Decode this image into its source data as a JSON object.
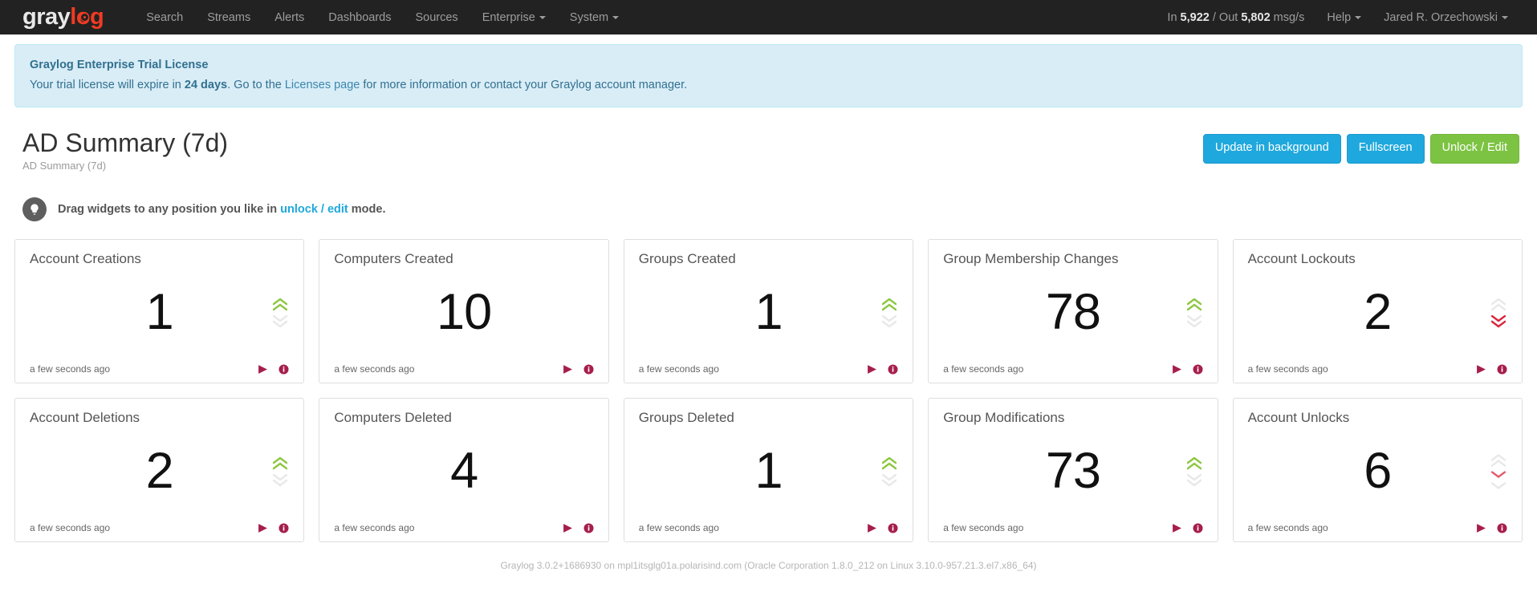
{
  "navbar": {
    "brand": {
      "gray": "gray",
      "log": "log"
    },
    "links": [
      {
        "label": "Search",
        "caret": false
      },
      {
        "label": "Streams",
        "caret": false
      },
      {
        "label": "Alerts",
        "caret": false
      },
      {
        "label": "Dashboards",
        "caret": false
      },
      {
        "label": "Sources",
        "caret": false
      },
      {
        "label": "Enterprise",
        "caret": true
      },
      {
        "label": "System",
        "caret": true
      }
    ],
    "throughput": {
      "in_prefix": "In ",
      "in_value": "5,922",
      "separator": " / Out ",
      "out_value": "5,802",
      "suffix": " msg/s"
    },
    "help_label": "Help",
    "user_label": "Jared R. Orzechowski"
  },
  "banner": {
    "title": "Graylog Enterprise Trial License",
    "body_before": "Your trial license will expire in ",
    "days": "24 days",
    "body_middle": ". Go to the ",
    "link": "Licenses page",
    "body_after": " for more information or contact your Graylog account manager."
  },
  "header": {
    "title": "AD Summary (7d)",
    "subtitle": "AD Summary (7d)",
    "buttons": [
      {
        "label": "Update in background",
        "style": "info"
      },
      {
        "label": "Fullscreen",
        "style": "info"
      },
      {
        "label": "Unlock / Edit",
        "style": "success"
      }
    ]
  },
  "hint": {
    "icon": "lightbulb-icon",
    "text_before": "Drag widgets to any position you like in ",
    "link": "unlock / edit",
    "text_after": " mode."
  },
  "colors": {
    "trend_up": "#8cc63f",
    "trend_down": "#d9253c",
    "trend_muted": "#e8e8e8",
    "accent_crimson": "#a61e4d",
    "brand_red": "#ef3b24",
    "btn_info": "#1fa8dd",
    "btn_success": "#7dc343"
  },
  "widgets": [
    {
      "title": "Account Creations",
      "value": "1",
      "timestamp": "a few seconds ago",
      "trend": "up",
      "trend_strength": "double"
    },
    {
      "title": "Computers Created",
      "value": "10",
      "timestamp": "a few seconds ago",
      "trend": "none",
      "trend_strength": "none"
    },
    {
      "title": "Groups Created",
      "value": "1",
      "timestamp": "a few seconds ago",
      "trend": "up",
      "trend_strength": "double"
    },
    {
      "title": "Group Membership Changes",
      "value": "78",
      "timestamp": "a few seconds ago",
      "trend": "up",
      "trend_strength": "double"
    },
    {
      "title": "Account Lockouts",
      "value": "2",
      "timestamp": "a few seconds ago",
      "trend": "down",
      "trend_strength": "double"
    },
    {
      "title": "Account Deletions",
      "value": "2",
      "timestamp": "a few seconds ago",
      "trend": "up",
      "trend_strength": "double"
    },
    {
      "title": "Computers Deleted",
      "value": "4",
      "timestamp": "a few seconds ago",
      "trend": "none",
      "trend_strength": "none"
    },
    {
      "title": "Groups Deleted",
      "value": "1",
      "timestamp": "a few seconds ago",
      "trend": "up",
      "trend_strength": "double"
    },
    {
      "title": "Group Modifications",
      "value": "73",
      "timestamp": "a few seconds ago",
      "trend": "up",
      "trend_strength": "double"
    },
    {
      "title": "Account Unlocks",
      "value": "6",
      "timestamp": "a few seconds ago",
      "trend": "down-weak",
      "trend_strength": "single"
    }
  ],
  "footer": {
    "text": "Graylog 3.0.2+1686930 on mpl1itsglg01a.polarisind.com (Oracle Corporation 1.8.0_212 on Linux 3.10.0-957.21.3.el7.x86_64)"
  }
}
